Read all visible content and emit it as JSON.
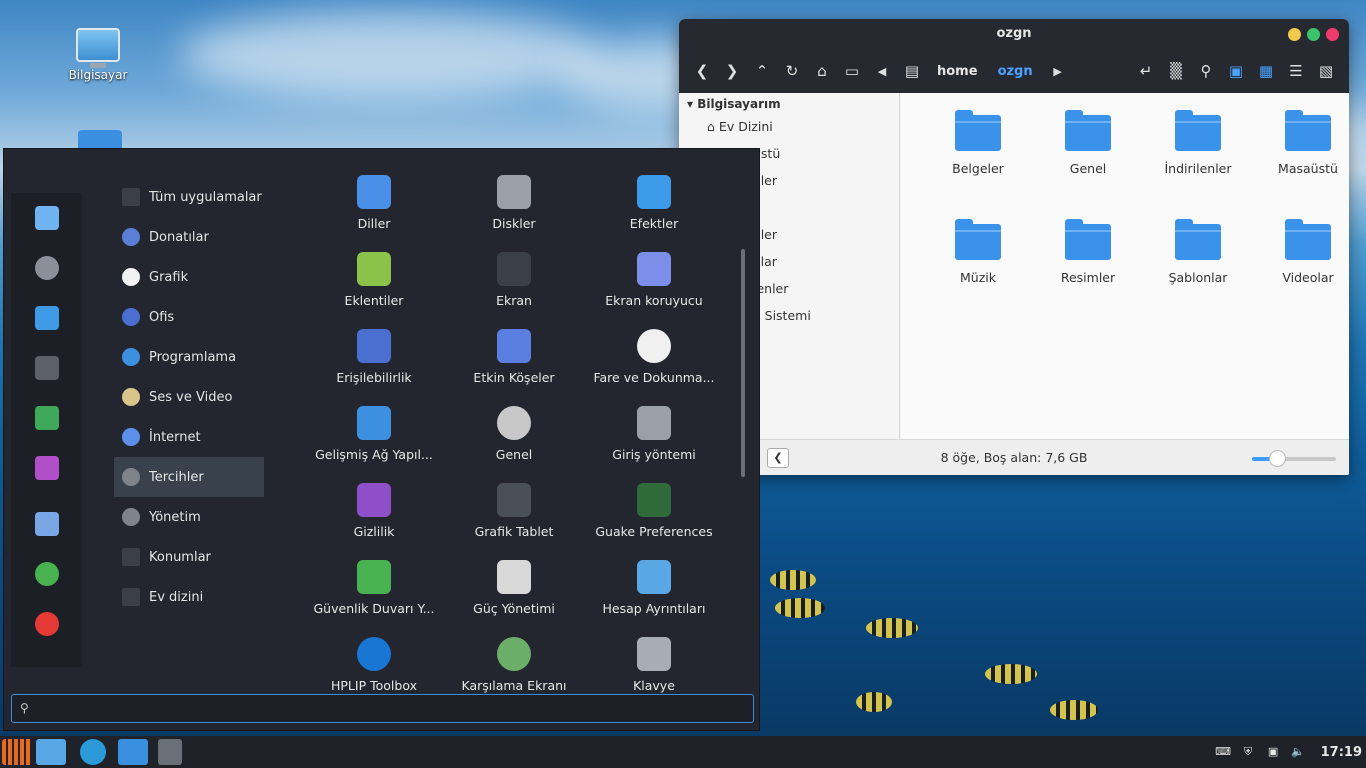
{
  "desktop": {
    "computer_label": "Bilgisayar"
  },
  "file_manager": {
    "title": "ozgn",
    "breadcrumbs": [
      "home",
      "ozgn"
    ],
    "sidebar_header": "Bilgisayarım",
    "sidebar_items": [
      "Ev Dizini",
      "üstü",
      "eler",
      "k",
      "eler",
      "olar",
      "lenler",
      "a Sistemi",
      "i"
    ],
    "folders": [
      "Belgeler",
      "Genel",
      "İndirilenler",
      "Masaüstü",
      "Müzik",
      "Resimler",
      "Şablonlar",
      "Videolar"
    ],
    "status": "8 öğe, Boş alan: 7,6 GB",
    "zoom_level": 0.3
  },
  "menu": {
    "categories": [
      "Tüm uygulamalar",
      "Donatılar",
      "Grafik",
      "Ofis",
      "Programlama",
      "Ses ve Video",
      "İnternet",
      "Tercihler",
      "Yönetim",
      "Konumlar",
      "Ev dizini"
    ],
    "selected_category": "Tercihler",
    "apps": [
      "Diller",
      "Diskler",
      "Efektler",
      "Eklentiler",
      "Ekran",
      "Ekran koruyucu",
      "Erişilebilirlik",
      "Etkin Köşeler",
      "Fare ve Dokunma...",
      "Gelişmiş Ağ Yapıl...",
      "Genel",
      "Giriş yöntemi",
      "Gizlilik",
      "Grafik Tablet",
      "Guake Preferences",
      "Güvenlik Duvarı Y...",
      "Güç Yönetimi",
      "Hesap Ayrıntıları",
      "HPLIP Toolbox",
      "Karşılama Ekranı",
      "Klavye"
    ],
    "search_value": "",
    "search_icon": "search-icon"
  },
  "panel": {
    "clock": "17:19"
  }
}
